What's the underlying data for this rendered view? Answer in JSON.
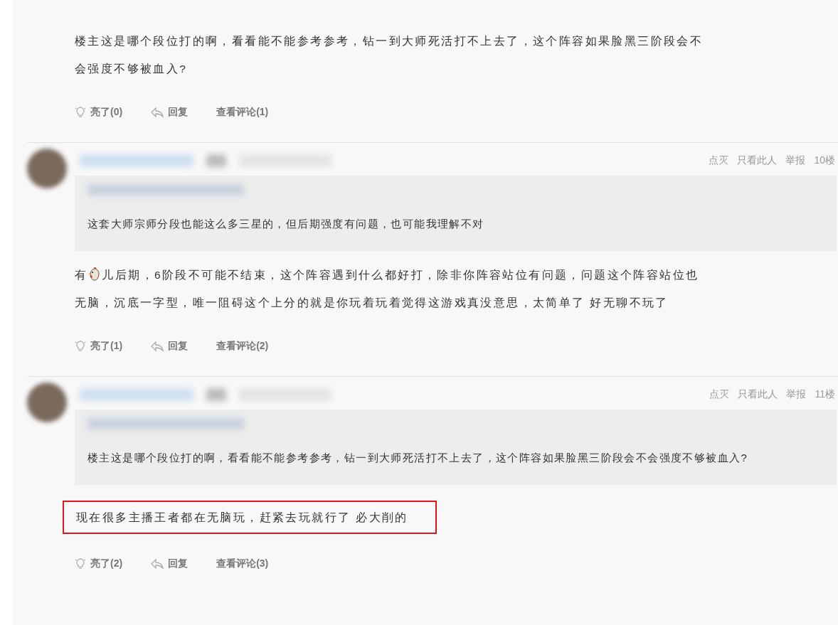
{
  "posts": [
    {
      "highlighted": false,
      "body": [
        {
          "kind": "text",
          "text": "楼主这是哪个段位打的啊，看看能不能参考参考，钻一到大师死活打不上去了，这个阵容如果脸黑三阶段会不会强度不够被血入?"
        }
      ],
      "actions": {
        "like": "亮了(0)",
        "reply": "回复",
        "comments": "查看评论(1)"
      }
    },
    {
      "menu": [
        "点灭",
        "只看此人",
        "举报"
      ],
      "floor": "10楼",
      "quote": "这套大师宗师分段也能这么多三星的，但后期强度有问题，也可能我理解不对",
      "highlighted": false,
      "body": [
        {
          "kind": "text",
          "text": "有"
        },
        {
          "kind": "emoji"
        },
        {
          "kind": "text",
          "text": "儿后期，6阶段不可能不结束，这个阵容遇到什么都好打，除非你阵容站位有问题，问题这个阵容站位也无脑，沉底一字型，唯一阻碍这个上分的就是你玩着玩着觉得这游戏真没意思，太简单了 好无聊不玩了"
        }
      ],
      "actions": {
        "like": "亮了(1)",
        "reply": "回复",
        "comments": "查看评论(2)"
      }
    },
    {
      "menu": [
        "点灭",
        "只看此人",
        "举报"
      ],
      "floor": "11楼",
      "quote": "楼主这是哪个段位打的啊，看看能不能参考参考，钻一到大师死活打不上去了，这个阵容如果脸黑三阶段会不会强度不够被血入?",
      "highlighted": true,
      "body": [
        {
          "kind": "text",
          "text": "现在很多主播王者都在无脑玩，赶紧去玩就行了 必大削的"
        }
      ],
      "actions": {
        "like": "亮了(2)",
        "reply": "回复",
        "comments": "查看评论(3)"
      }
    }
  ]
}
